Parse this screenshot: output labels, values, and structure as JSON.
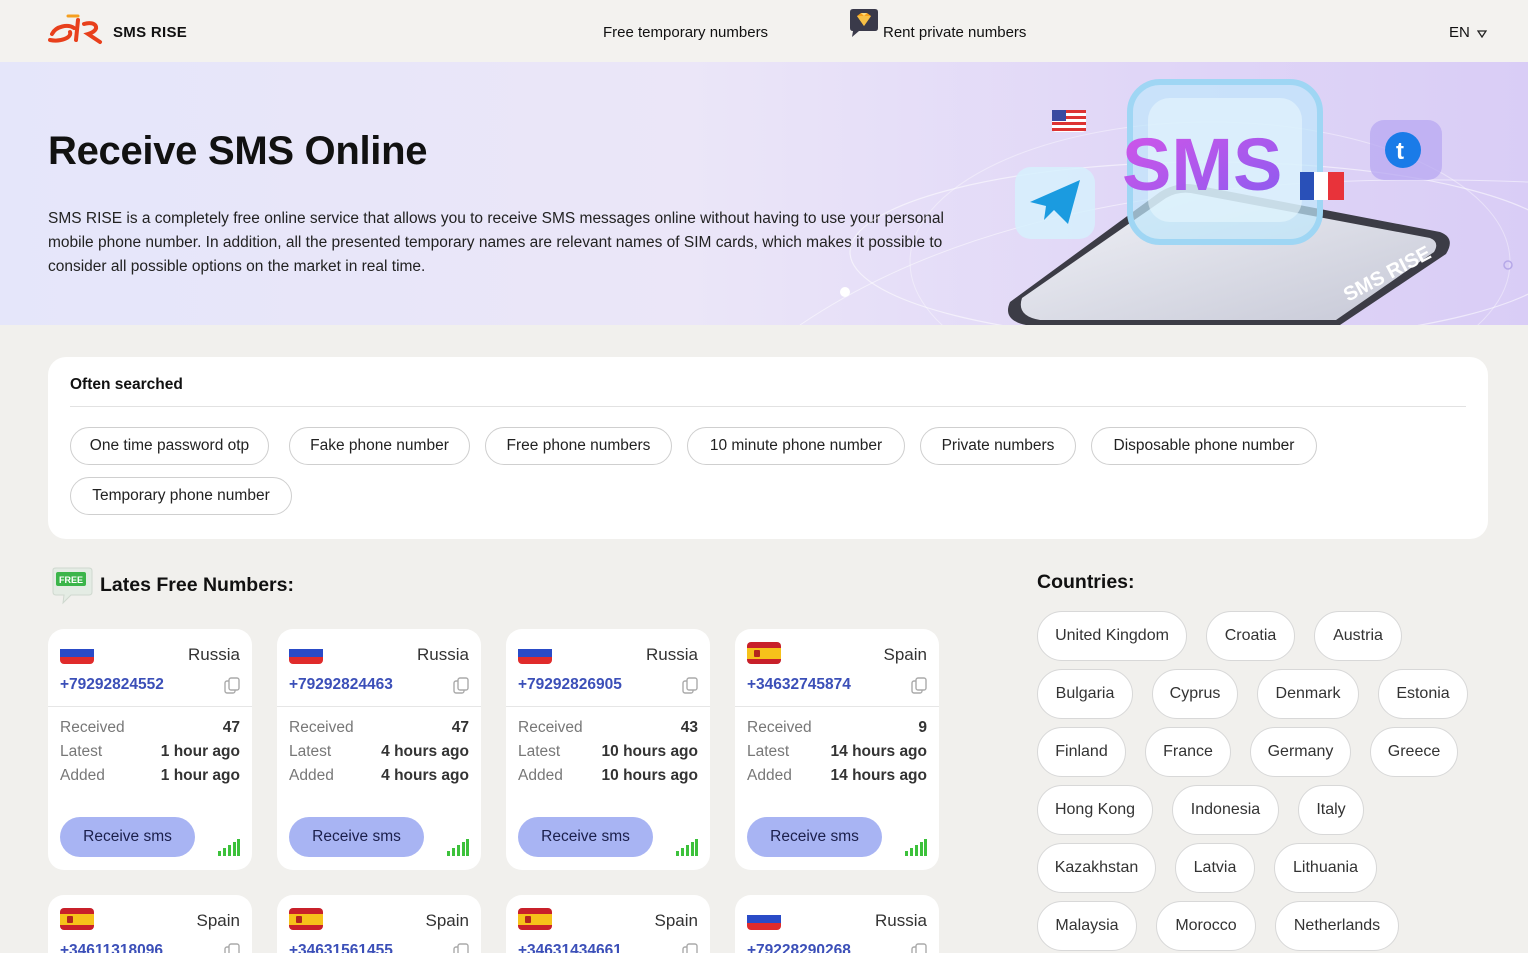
{
  "header": {
    "brand": "SMS RISE",
    "nav_free": "Free temporary numbers",
    "nav_rent": "Rent private numbers",
    "lang": "EN"
  },
  "hero": {
    "title": "Receive SMS Online",
    "description": "SMS RISE is a completely free online service that allows you to receive SMS messages online without having to use your personal mobile phone number. In addition, all the presented temporary names are relevant names of SIM cards, which makes it possible to consider all possible options on the market in real time.",
    "art_sms_text": "SMS",
    "art_phone_text": "SMS RISE"
  },
  "often": {
    "title": "Often searched",
    "chips": [
      "One time password otp",
      "Fake phone number",
      "Free phone numbers",
      "10 minute phone number",
      "Private numbers",
      "Disposable phone number",
      "Temporary phone number"
    ]
  },
  "latest": {
    "title": "Lates Free Numbers:",
    "badge": "FREE",
    "received_label": "Received",
    "latest_label": "Latest",
    "added_label": "Added",
    "button_label": "Receive sms",
    "cards": [
      {
        "country": "Russia",
        "flag": "ru",
        "number": "+79292824552",
        "received": "47",
        "latest": "1 hour ago",
        "added": "1 hour ago"
      },
      {
        "country": "Russia",
        "flag": "ru",
        "number": "+79292824463",
        "received": "47",
        "latest": "4 hours ago",
        "added": "4 hours ago"
      },
      {
        "country": "Russia",
        "flag": "ru",
        "number": "+79292826905",
        "received": "43",
        "latest": "10 hours ago",
        "added": "10 hours ago"
      },
      {
        "country": "Spain",
        "flag": "es",
        "number": "+34632745874",
        "received": "9",
        "latest": "14 hours ago",
        "added": "14 hours ago"
      },
      {
        "country": "Spain",
        "flag": "es",
        "number": "+34611318096"
      },
      {
        "country": "Spain",
        "flag": "es",
        "number": "+34631561455"
      },
      {
        "country": "Spain",
        "flag": "es",
        "number": "+34631434661"
      },
      {
        "country": "Russia",
        "flag": "ru",
        "number": "+79228290268"
      }
    ]
  },
  "countries": {
    "title": "Countries:",
    "items": [
      "United Kingdom",
      "Croatia",
      "Austria",
      "Bulgaria",
      "Cyprus",
      "Denmark",
      "Estonia",
      "Finland",
      "France",
      "Germany",
      "Greece",
      "Hong Kong",
      "Indonesia",
      "Italy",
      "Kazakhstan",
      "Latvia",
      "Lithuania",
      "Malaysia",
      "Morocco",
      "Netherlands"
    ]
  },
  "colors": {
    "accent": "#a8b4f3",
    "number": "#3b4fb8",
    "brand_red": "#e8401c",
    "signal": "#3cc13b"
  }
}
